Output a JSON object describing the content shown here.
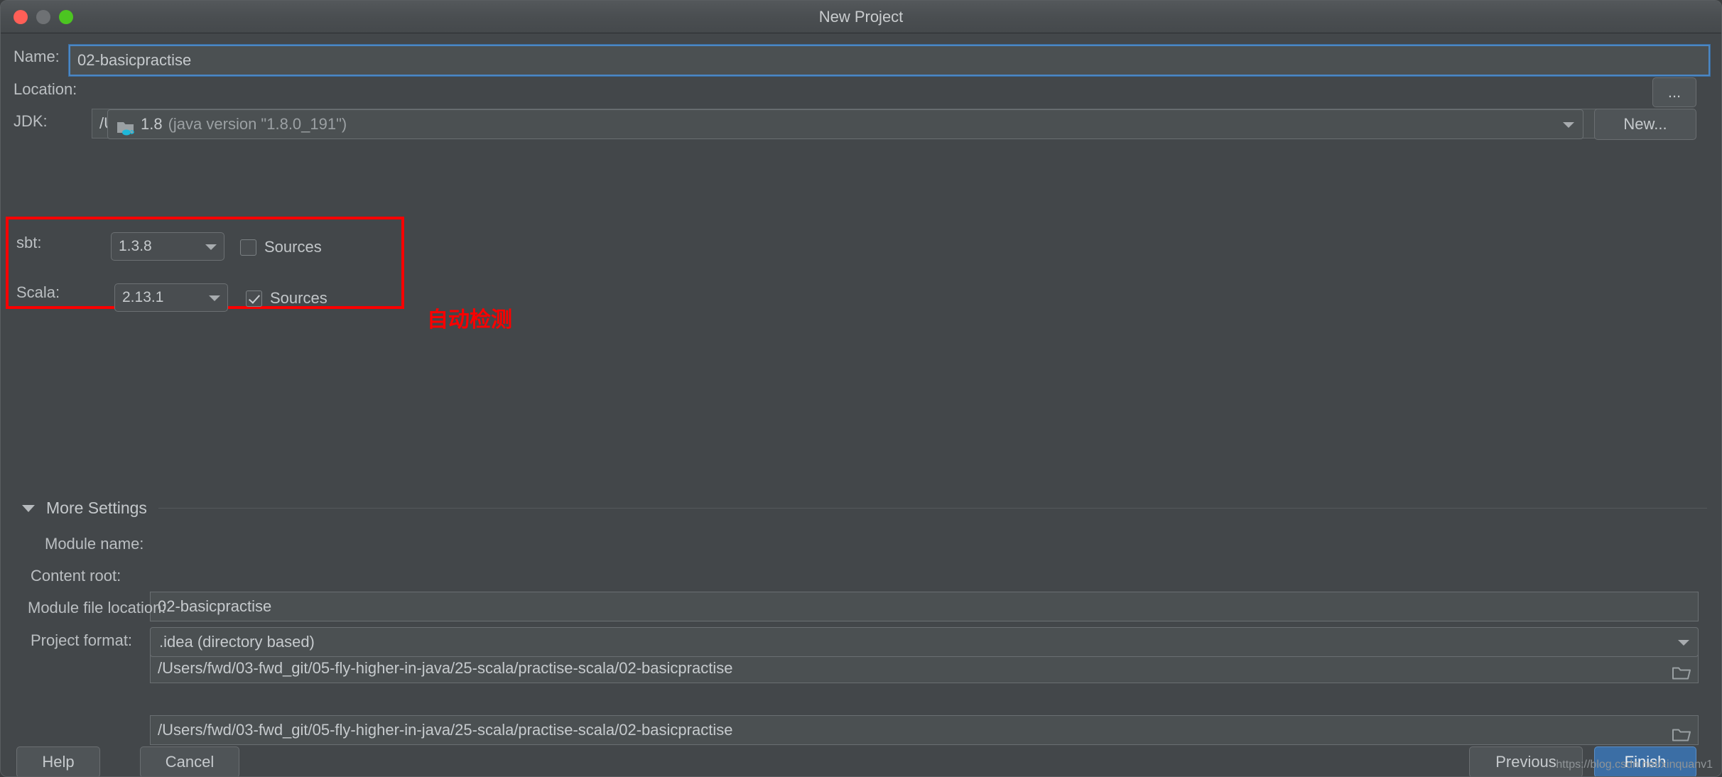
{
  "window": {
    "title": "New Project",
    "controls": [
      "close-button",
      "minimize-button",
      "zoom-button"
    ]
  },
  "form": {
    "name": {
      "label": "Name:",
      "value": "02-basicpractise"
    },
    "location": {
      "label": "Location:",
      "value": "/Users/fwd/03-fwd_git/05-fly-higher-in-java/25-scala/practise-scala/02-basicpractise",
      "browse_label": "..."
    },
    "jdk": {
      "label": "JDK:",
      "value": "1.8",
      "detail": "(java version \"1.8.0_191\")",
      "new_label": "New..."
    },
    "sbt": {
      "label": "sbt:",
      "version": "1.3.8",
      "sources_label": "Sources",
      "sources_checked": false
    },
    "scala": {
      "label": "Scala:",
      "version": "2.13.1",
      "sources_label": "Sources",
      "sources_checked": true
    }
  },
  "annotation": {
    "text": "自动检测",
    "color": "#fb0000"
  },
  "more_settings": {
    "title": "More Settings",
    "expanded": true,
    "fields": [
      {
        "label": "Module name:",
        "value": "02-basicpractise",
        "has_folder": false,
        "has_caret": false
      },
      {
        "label": "Content root:",
        "value": "/Users/fwd/03-fwd_git/05-fly-higher-in-java/25-scala/practise-scala/02-basicpractise",
        "has_folder": true,
        "has_caret": false
      },
      {
        "label": "Module file location:",
        "value": "/Users/fwd/03-fwd_git/05-fly-higher-in-java/25-scala/practise-scala/02-basicpractise",
        "has_folder": true,
        "has_caret": false
      },
      {
        "label": "Project format:",
        "value": ".idea (directory based)",
        "has_folder": false,
        "has_caret": true
      }
    ]
  },
  "footer": {
    "help_label": "Help",
    "cancel_label": "Cancel",
    "previous_label": "Previous",
    "finish_label": "Finish",
    "finish_color": "#3b6ea5"
  },
  "watermark": "https://blog.csdn.net/xinquanv1"
}
